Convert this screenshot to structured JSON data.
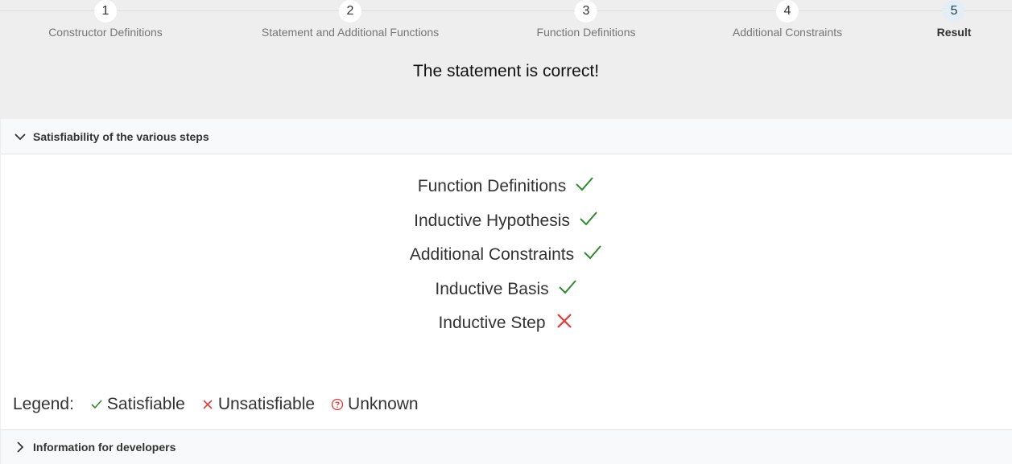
{
  "stepper": {
    "steps": [
      {
        "number": "1",
        "label": "Constructor Definitions"
      },
      {
        "number": "2",
        "label": "Statement and Additional Functions"
      },
      {
        "number": "3",
        "label": "Function Definitions"
      },
      {
        "number": "4",
        "label": "Additional Constraints"
      },
      {
        "number": "5",
        "label": "Result"
      }
    ],
    "active_step": "5"
  },
  "result_message": "The statement is correct!",
  "satisfiability_panel": {
    "title": "Satisfiability of the various steps",
    "expanded": true,
    "steps": [
      {
        "label": "Function Definitions",
        "status": "check-icon"
      },
      {
        "label": "Inductive Hypothesis",
        "status": "check-icon"
      },
      {
        "label": "Additional Constraints",
        "status": "check-icon"
      },
      {
        "label": "Inductive Basis",
        "status": "check-icon"
      },
      {
        "label": "Inductive Step",
        "status": "cross-icon"
      }
    ],
    "legend": {
      "label": "Legend:",
      "satisfiable": "Satisfiable",
      "unsatisfiable": "Unsatisfiable",
      "unknown": "Unknown"
    }
  },
  "developer_panel": {
    "title": "Information for developers",
    "expanded": false
  },
  "colors": {
    "satisfiable": "#2e8b2e",
    "unsatisfiable": "#e53935",
    "unknown": "#e53935"
  }
}
